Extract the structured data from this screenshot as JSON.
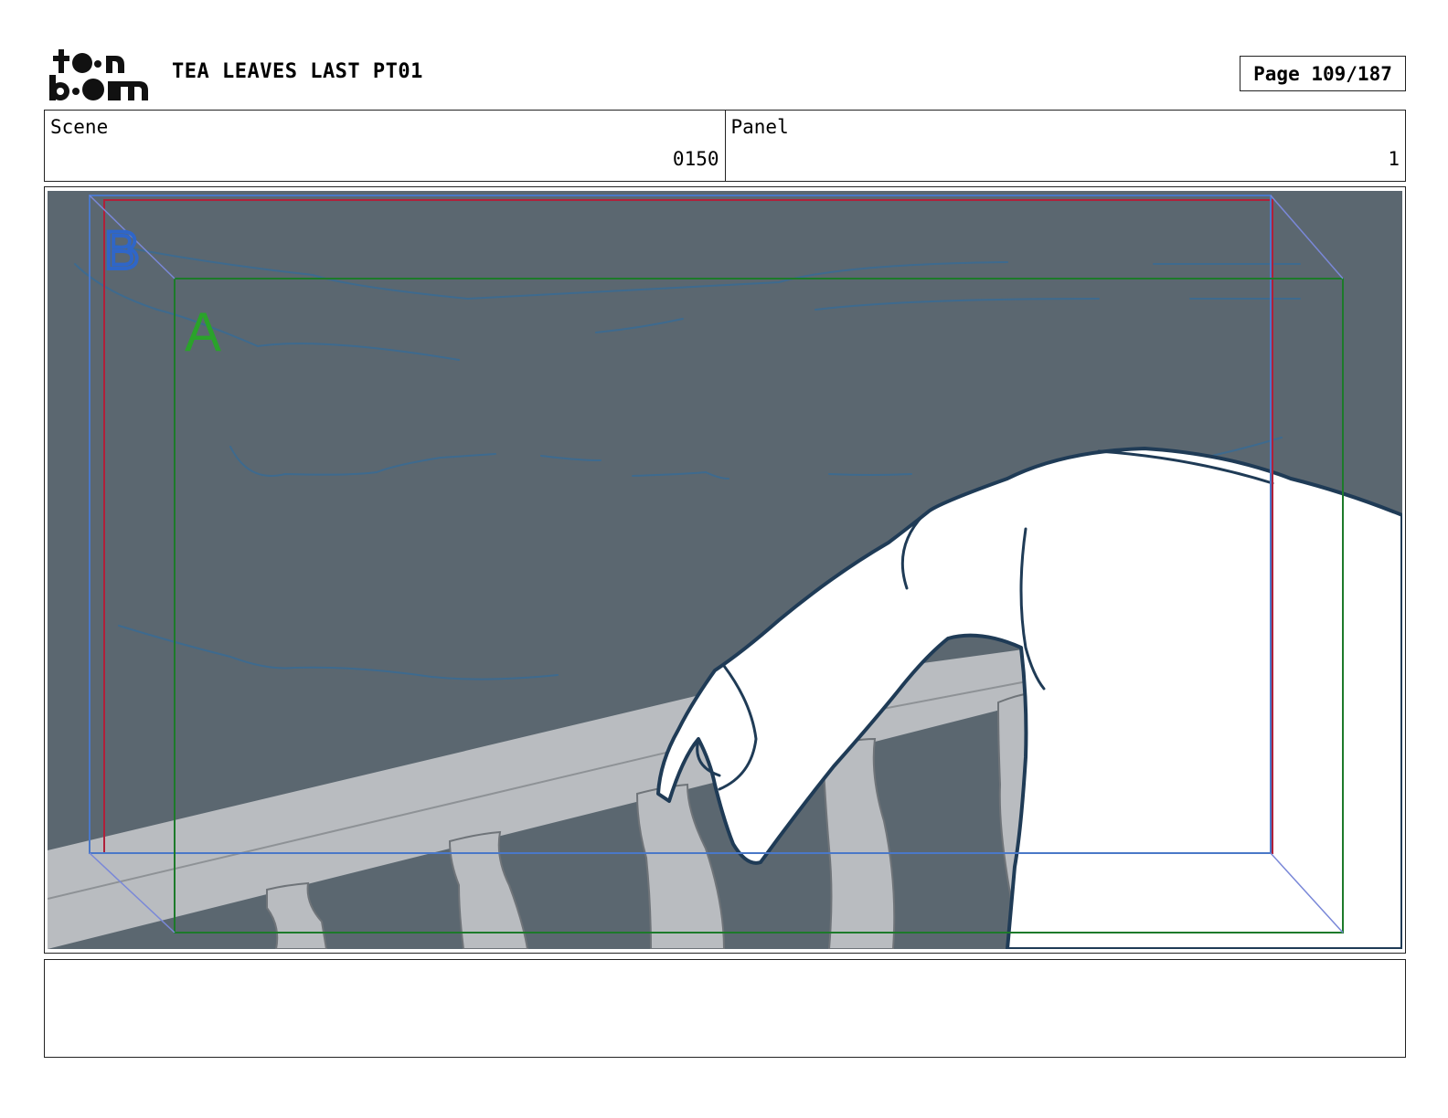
{
  "header": {
    "logo_text_top": "toon",
    "logo_text_bottom": "boom",
    "title": "TEA LEAVES LAST PT01",
    "page": "Page 109/187"
  },
  "info": {
    "scene_label": "Scene",
    "scene_value": "0150",
    "panel_label": "Panel",
    "panel_value": "1"
  },
  "panel": {
    "field_marker_a": "A",
    "field_marker_b": "B",
    "colors": {
      "sky": "#5b6770",
      "sky_lines": "#3e6a8e",
      "railing": "#b9bcc0",
      "figure_fill": "#ffffff",
      "figure_line": "#1f3b56",
      "frame_red": "#b0203a",
      "frame_blue": "#4a78c8",
      "frame_green": "#1d7a2a"
    }
  },
  "notes": {
    "text": ""
  }
}
